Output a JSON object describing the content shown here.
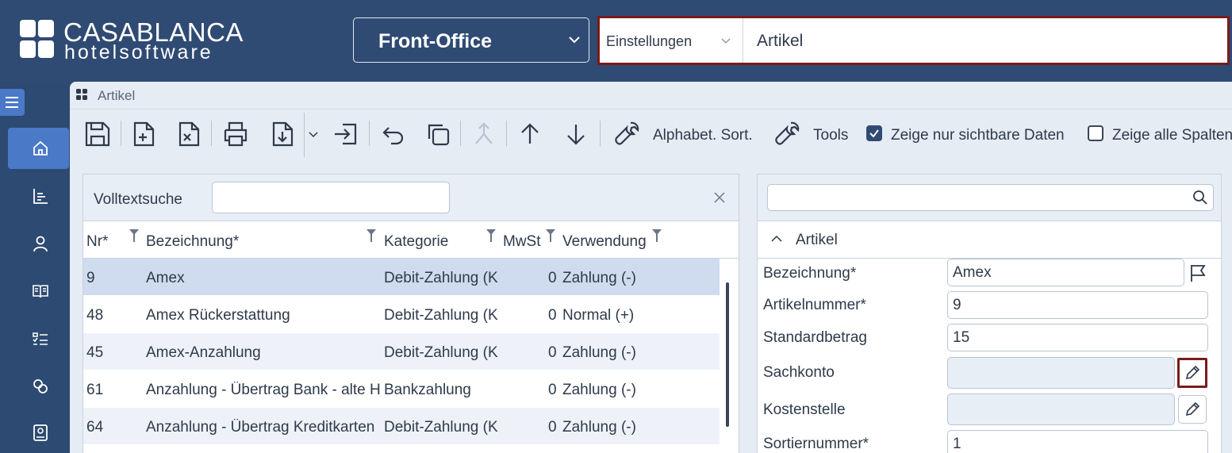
{
  "brand": {
    "name_line1": "CASABLANCA",
    "name_line2": "hotelsoftware"
  },
  "module_select": {
    "value": "Front-Office"
  },
  "global_search": {
    "category": "Einstellungen",
    "value": "Artikel"
  },
  "window": {
    "title": "Artikel"
  },
  "toolbar": {
    "alpha_sort_label": "Alphabet. Sort.",
    "tools_label": "Tools",
    "visible_only_label": "Zeige nur sichtbare Daten",
    "visible_only_checked": true,
    "all_columns_label": "Zeige alle Spalten",
    "all_columns_checked": false
  },
  "list": {
    "search_label": "Volltextsuche",
    "search_value": "",
    "columns": [
      "Nr*",
      "Bezeichnung*",
      "Kategorie",
      "MwSt",
      "Verwendung"
    ],
    "rows": [
      {
        "nr": "9",
        "bez": "Amex",
        "kat": "Debit-Zahlung (K",
        "mwst": "0",
        "verw": "Zahlung (-)"
      },
      {
        "nr": "48",
        "bez": "Amex Rückerstattung",
        "kat": "Debit-Zahlung (K",
        "mwst": "0",
        "verw": "Normal (+)"
      },
      {
        "nr": "45",
        "bez": "Amex-Anzahlung",
        "kat": "Debit-Zahlung (K",
        "mwst": "0",
        "verw": "Zahlung (-)"
      },
      {
        "nr": "61",
        "bez": "Anzahlung - Übertrag Bank - alte H",
        "kat": "Bankzahlung",
        "mwst": "0",
        "verw": "Zahlung (-)"
      },
      {
        "nr": "64",
        "bez": "Anzahlung - Übertrag Kreditkarten",
        "kat": "Debit-Zahlung (K",
        "mwst": "0",
        "verw": "Zahlung (-)"
      }
    ]
  },
  "detail": {
    "search_value": "",
    "section_title": "Artikel",
    "fields": {
      "bezeichnung": {
        "label": "Bezeichnung*",
        "value": "Amex"
      },
      "artikelnummer": {
        "label": "Artikelnummer*",
        "value": "9"
      },
      "standardbetrag": {
        "label": "Standardbetrag",
        "value": "15"
      },
      "sachkonto": {
        "label": "Sachkonto",
        "value": ""
      },
      "kostenstelle": {
        "label": "Kostenstelle",
        "value": ""
      },
      "sortiernummer": {
        "label": "Sortiernummer*",
        "value": "1"
      }
    }
  },
  "colors": {
    "nav": "#2f4b73",
    "accent": "#4a79c7",
    "highlight": "#7a1b1b",
    "selected_row": "#cfdcef"
  }
}
